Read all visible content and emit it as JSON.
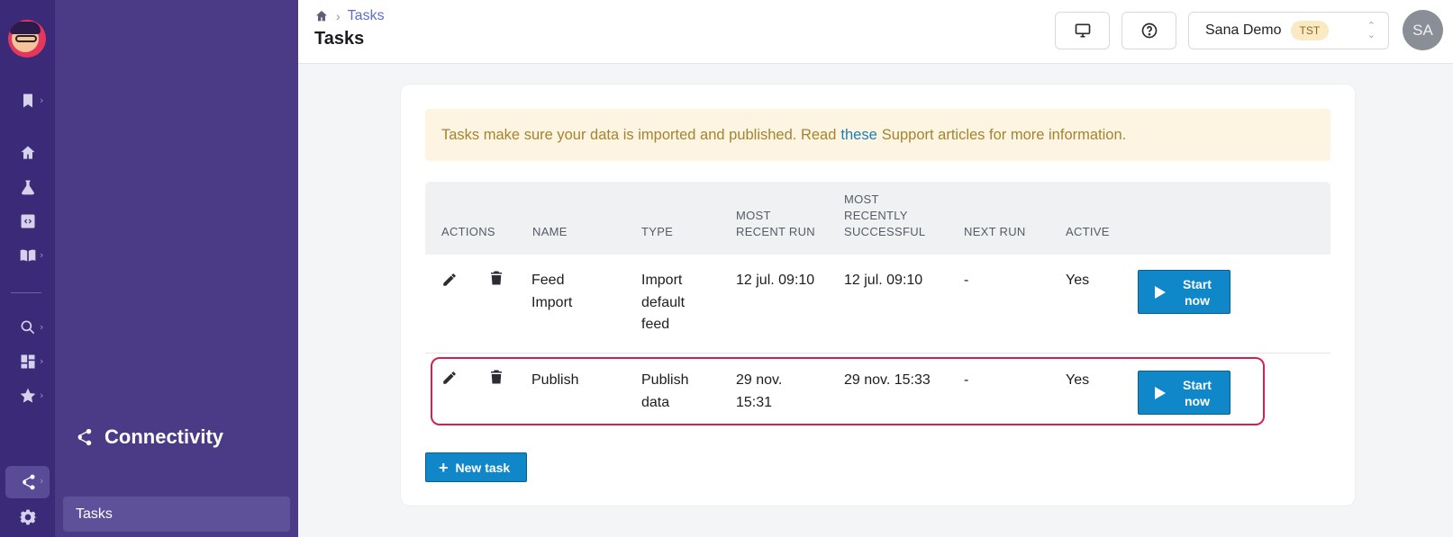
{
  "breadcrumb": {
    "current": "Tasks"
  },
  "page": {
    "title": "Tasks"
  },
  "account": {
    "name": "Sana Demo",
    "env_badge": "TST"
  },
  "user": {
    "initials": "SA"
  },
  "subnav": {
    "section_title": "Connectivity",
    "items": [
      {
        "label": "Tasks"
      }
    ]
  },
  "notice": {
    "text_before": "Tasks make sure your data is imported and published. Read",
    "link_text": "these",
    "text_after": "Support articles for more information."
  },
  "table": {
    "headers": {
      "actions": "ACTIONS",
      "name": "NAME",
      "type": "TYPE",
      "most_recent_run_1": "MOST",
      "most_recent_run_2": "RECENT RUN",
      "most_recent_success_1": "MOST",
      "most_recent_success_2": "RECENTLY",
      "most_recent_success_3": "SUCCESSFUL",
      "next_run": "NEXT RUN",
      "active": "ACTIVE"
    },
    "rows": [
      {
        "name_1": "Feed",
        "name_2": "Import",
        "type_1": "Import",
        "type_2": "default",
        "type_3": "feed",
        "most_recent_run": "12 jul. 09:10",
        "most_recent_success": "12 jul. 09:10",
        "next_run": "-",
        "active": "Yes",
        "start_1": "Start",
        "start_2": "now"
      },
      {
        "name_1": "Publish",
        "type_1": "Publish",
        "type_2": "data",
        "most_recent_run_1": "29 nov.",
        "most_recent_run_2": "15:31",
        "most_recent_success": "29 nov. 15:33",
        "next_run": "-",
        "active": "Yes",
        "start_1": "Start",
        "start_2": "now"
      }
    ]
  },
  "new_task_label": "New task",
  "colors": {
    "rail": "#3a2a78",
    "subnav": "#4b3b87",
    "primary_button": "#0f87c9",
    "highlight": "#d3214f",
    "notice_bg": "#fdf5e1"
  }
}
